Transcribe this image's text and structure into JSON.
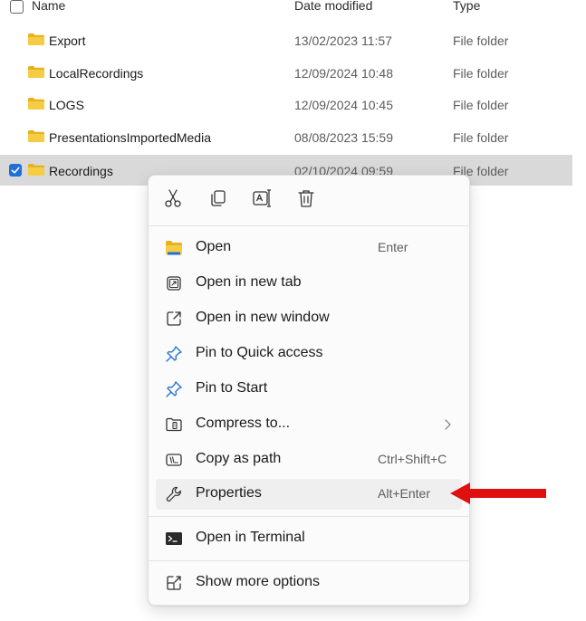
{
  "columns": {
    "name": "Name",
    "date": "Date modified",
    "type": "Type"
  },
  "rows": [
    {
      "name": "Export",
      "date": "13/02/2023 11:57",
      "type": "File folder",
      "selected": false
    },
    {
      "name": "LocalRecordings",
      "date": "12/09/2024 10:48",
      "type": "File folder",
      "selected": false
    },
    {
      "name": "LOGS",
      "date": "12/09/2024 10:45",
      "type": "File folder",
      "selected": false
    },
    {
      "name": "PresentationsImportedMedia",
      "date": "08/08/2023 15:59",
      "type": "File folder",
      "selected": false
    },
    {
      "name": "Recordings",
      "date": "02/10/2024 09:59",
      "type": "File folder",
      "selected": true
    }
  ],
  "context_menu": {
    "quick_actions": [
      "cut-icon",
      "copy-icon",
      "rename-icon",
      "delete-icon"
    ],
    "items": [
      {
        "label": "Open",
        "shortcut": "Enter",
        "icon": "folder-open-icon"
      },
      {
        "label": "Open in new tab",
        "shortcut": "",
        "icon": "new-tab-icon"
      },
      {
        "label": "Open in new window",
        "shortcut": "",
        "icon": "new-window-icon"
      },
      {
        "label": "Pin to Quick access",
        "shortcut": "",
        "icon": "pin-icon"
      },
      {
        "label": "Pin to Start",
        "shortcut": "",
        "icon": "pin-icon"
      },
      {
        "label": "Compress to...",
        "shortcut": "",
        "icon": "archive-icon",
        "submenu": true
      },
      {
        "label": "Copy as path",
        "shortcut": "Ctrl+Shift+C",
        "icon": "copy-path-icon"
      },
      {
        "label": "Properties",
        "shortcut": "Alt+Enter",
        "icon": "wrench-icon",
        "highlighted": true
      },
      {
        "label": "Open in Terminal",
        "shortcut": "",
        "icon": "terminal-icon"
      },
      {
        "label": "Show more options",
        "shortcut": "",
        "icon": "more-options-icon"
      }
    ]
  },
  "colors": {
    "selection_bg": "#d9d9d9",
    "checkbox_accent": "#1f6fd6",
    "folder_yellow": "#f4c430",
    "arrow_red": "#e01010"
  }
}
